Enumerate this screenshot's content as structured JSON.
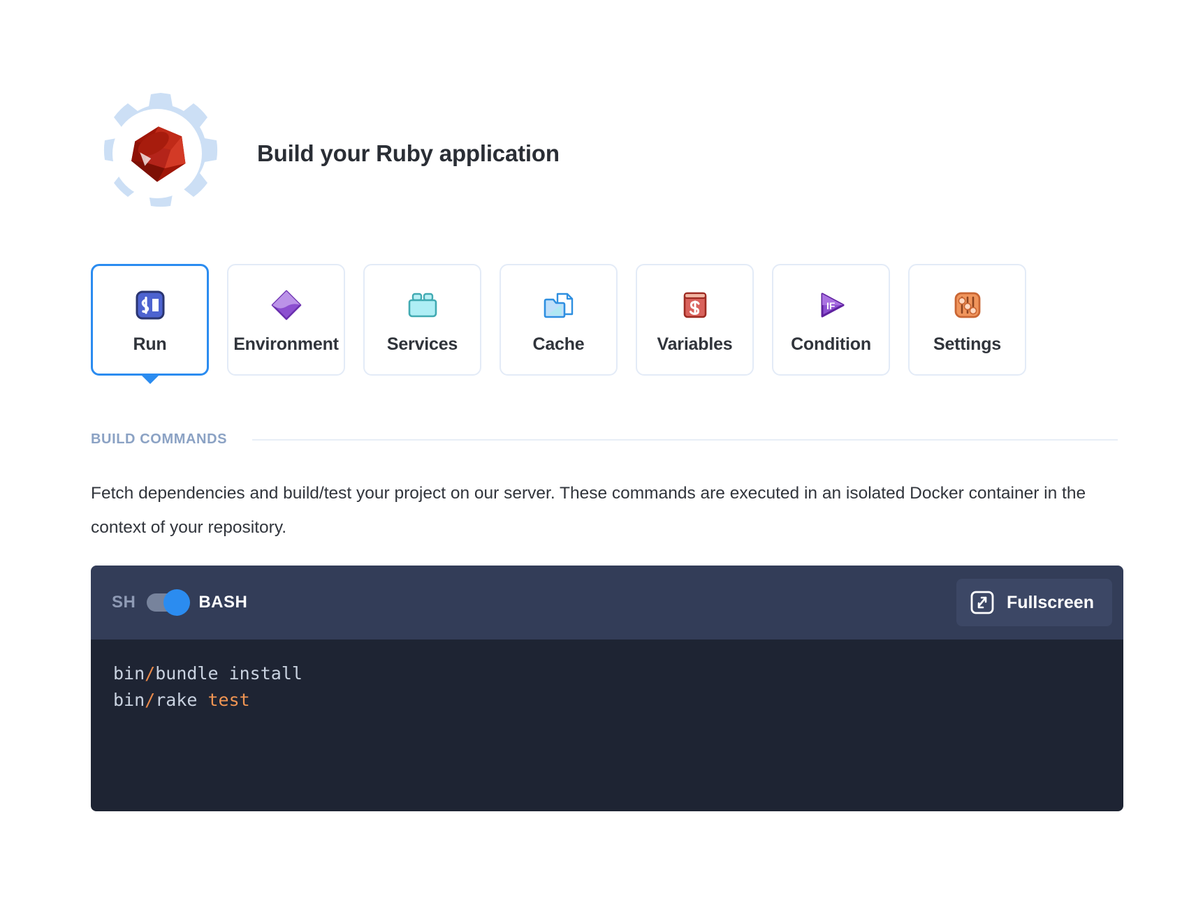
{
  "header": {
    "title": "Build your Ruby application",
    "logo_icon": "ruby-gem-icon",
    "gear_icon": "gear-outline-icon",
    "gear_color": "#ccdff5",
    "gem_color": "#b11e10"
  },
  "tabs": {
    "active": "Run",
    "items": [
      {
        "label": "Run",
        "icon": "terminal-prompt-icon",
        "color": "#4d63d0",
        "active": true
      },
      {
        "label": "Environment",
        "icon": "purple-diamond-icon",
        "color": "#9b6cd8",
        "active": false
      },
      {
        "label": "Services",
        "icon": "crate-box-icon",
        "color": "#9ae9ef",
        "active": false
      },
      {
        "label": "Cache",
        "icon": "folder-document-icon",
        "color": "#2e8fe0",
        "active": false
      },
      {
        "label": "Variables",
        "icon": "dollar-card-icon",
        "color": "#d9625c",
        "active": false
      },
      {
        "label": "Condition",
        "icon": "if-play-icon",
        "color": "#7b3fc4",
        "active": false
      },
      {
        "label": "Settings",
        "icon": "sliders-icon",
        "color": "#f0955c",
        "active": false
      }
    ]
  },
  "section": {
    "title": "BUILD COMMANDS",
    "description": "Fetch dependencies and build/test your project on our server. These commands are executed in an isolated Docker container in the context of your repository."
  },
  "editor": {
    "lang_off_label": "SH",
    "lang_on_label": "BASH",
    "toggle_on": true,
    "fullscreen_label": "Fullscreen",
    "fullscreen_icon": "expand-icon",
    "lines": [
      [
        {
          "t": "bin",
          "c": "plain"
        },
        {
          "t": "/",
          "c": "op"
        },
        {
          "t": "bundle install",
          "c": "plain"
        }
      ],
      [
        {
          "t": "bin",
          "c": "plain"
        },
        {
          "t": "/",
          "c": "op"
        },
        {
          "t": "rake ",
          "c": "plain"
        },
        {
          "t": "test",
          "c": "str"
        }
      ]
    ]
  },
  "colors": {
    "accent_blue": "#2b8cf0",
    "tab_border": "#e3ebf7",
    "toolbar_bg": "#333d58",
    "code_bg": "#1e2433",
    "section_label": "#8ba2c4"
  }
}
